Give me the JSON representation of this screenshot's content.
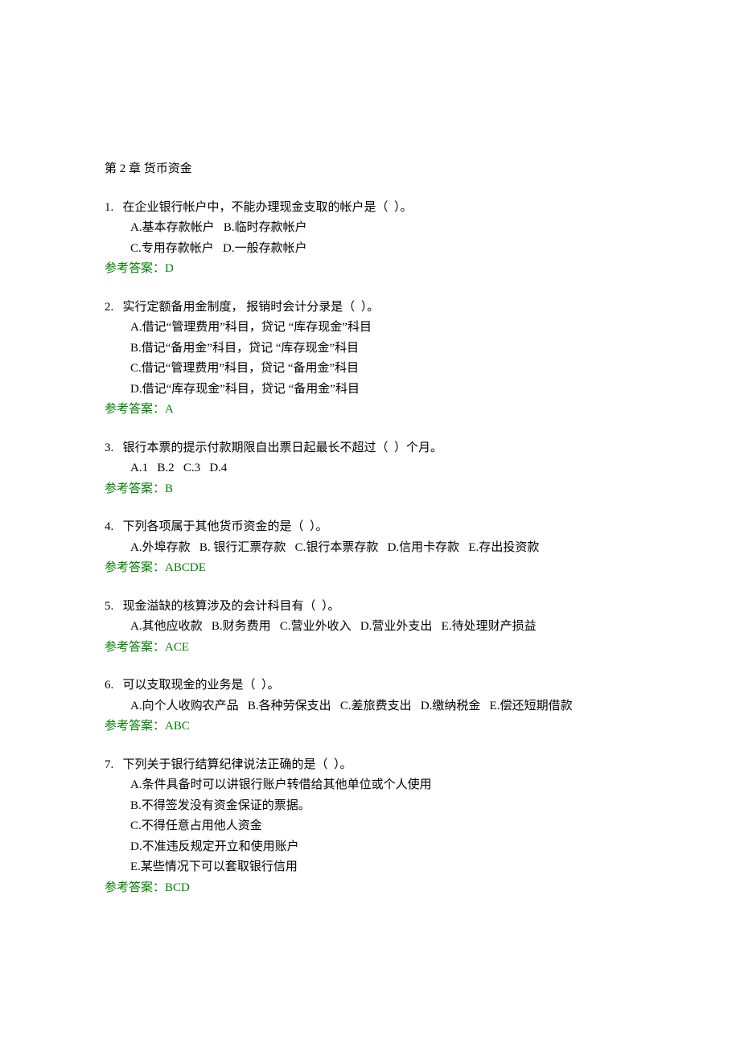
{
  "chapter_title": "第 2 章 货币资金",
  "questions": [
    {
      "num": "1.",
      "stem": "在企业银行帐户中，不能办理现金支取的帐户是（  ）。",
      "option_lines": [
        "A.基本存款帐户   B.临时存款帐户",
        "C.专用存款帐户   D.一般存款帐户"
      ],
      "answer_label": "参考答案：",
      "answer_value": "D"
    },
    {
      "num": "2.",
      "stem": "实行定额备用金制度， 报销时会计分录是（  ）。",
      "option_lines": [
        "A.借记“管理费用”科目，贷记 “库存现金”科目",
        "B.借记“备用金”科目，贷记 “库存现金”科目",
        "C.借记“管理费用”科目，贷记 “备用金”科目",
        "D.借记“库存现金”科目，贷记 “备用金”科目"
      ],
      "answer_label": "参考答案：",
      "answer_value": "A"
    },
    {
      "num": "3.",
      "stem": "银行本票的提示付款期限自出票日起最长不超过（  ）个月。",
      "option_lines": [
        "A.1   B.2   C.3   D.4"
      ],
      "answer_label": "参考答案：",
      "answer_value": "B"
    },
    {
      "num": "4.",
      "stem": "下列各项属于其他货币资金的是（  ）。",
      "option_lines": [
        "A.外埠存款   B. 银行汇票存款   C.银行本票存款   D.信用卡存款   E.存出投资款"
      ],
      "answer_label": "参考答案：",
      "answer_value": "ABCDE"
    },
    {
      "num": "5.",
      "stem": "现金溢缺的核算涉及的会计科目有（  ）。",
      "option_lines": [
        "A.其他应收款   B.财务费用   C.营业外收入   D.营业外支出   E.待处理财产损益"
      ],
      "answer_label": "参考答案：",
      "answer_value": "ACE"
    },
    {
      "num": "6.",
      "stem": "可以支取现金的业务是（  ）。",
      "option_lines": [
        "A.向个人收购农产品   B.各种劳保支出   C.差旅费支出   D.缴纳税金   E.偿还短期借款"
      ],
      "answer_label": "参考答案：",
      "answer_value": "ABC"
    },
    {
      "num": "7.",
      "stem": "下列关于银行结算纪律说法正确的是（  ）。",
      "option_lines": [
        "A.条件具备时可以讲银行账户转借给其他单位或个人使用",
        "B.不得签发没有资金保证的票据。",
        "C.不得任意占用他人资金",
        "D.不准违反规定开立和使用账户",
        "E.某些情况下可以套取银行信用"
      ],
      "answer_label": "参考答案：",
      "answer_value": "BCD"
    }
  ]
}
